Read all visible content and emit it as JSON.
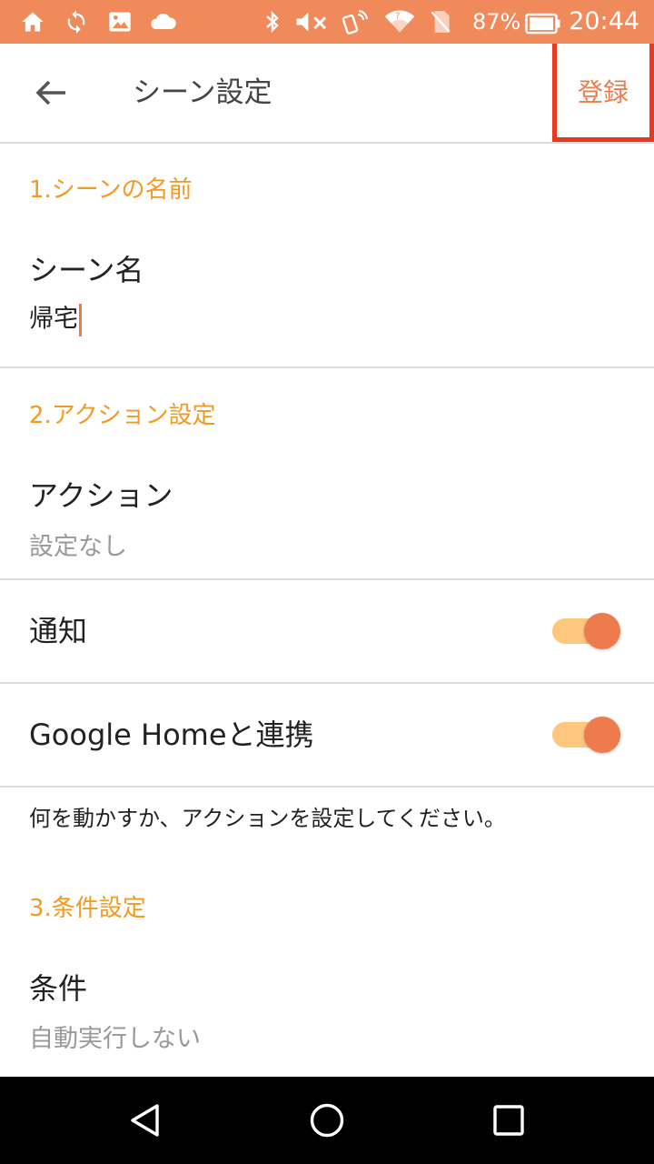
{
  "colors": {
    "status_bg": "#F08A5A",
    "accent": "#EE7B4E",
    "section": "#F39A22",
    "toggle_track": "#FFC77E"
  },
  "status_bar": {
    "icons_left": [
      "home-icon",
      "sync-icon",
      "image-icon",
      "cloud-icon"
    ],
    "icons_right": [
      "bluetooth-icon",
      "mute-icon",
      "nfc-icon",
      "wifi-icon",
      "no-sim-icon",
      "battery-icon"
    ],
    "battery": "87%",
    "time": "20:44"
  },
  "app_bar": {
    "back_icon": "arrow-left-icon",
    "title": "シーン設定",
    "register_label": "登録"
  },
  "sections": {
    "s1": {
      "header": "1.シーンの名前",
      "name_label": "シーン名",
      "name_value": "帰宅"
    },
    "s2": {
      "header": "2.アクション設定",
      "action_label": "アクション",
      "action_value": "設定なし",
      "notify_label": "通知",
      "notify_on": true,
      "google_home_label": "Google Homeと連携",
      "google_home_on": true,
      "hint": "何を動かすか、アクションを設定してください。"
    },
    "s3": {
      "header": "3.条件設定",
      "condition_label": "条件",
      "condition_value": "自動実行しない"
    }
  },
  "nav_bar": {
    "icons": [
      "back-triangle-icon",
      "home-circle-icon",
      "recents-square-icon"
    ]
  }
}
